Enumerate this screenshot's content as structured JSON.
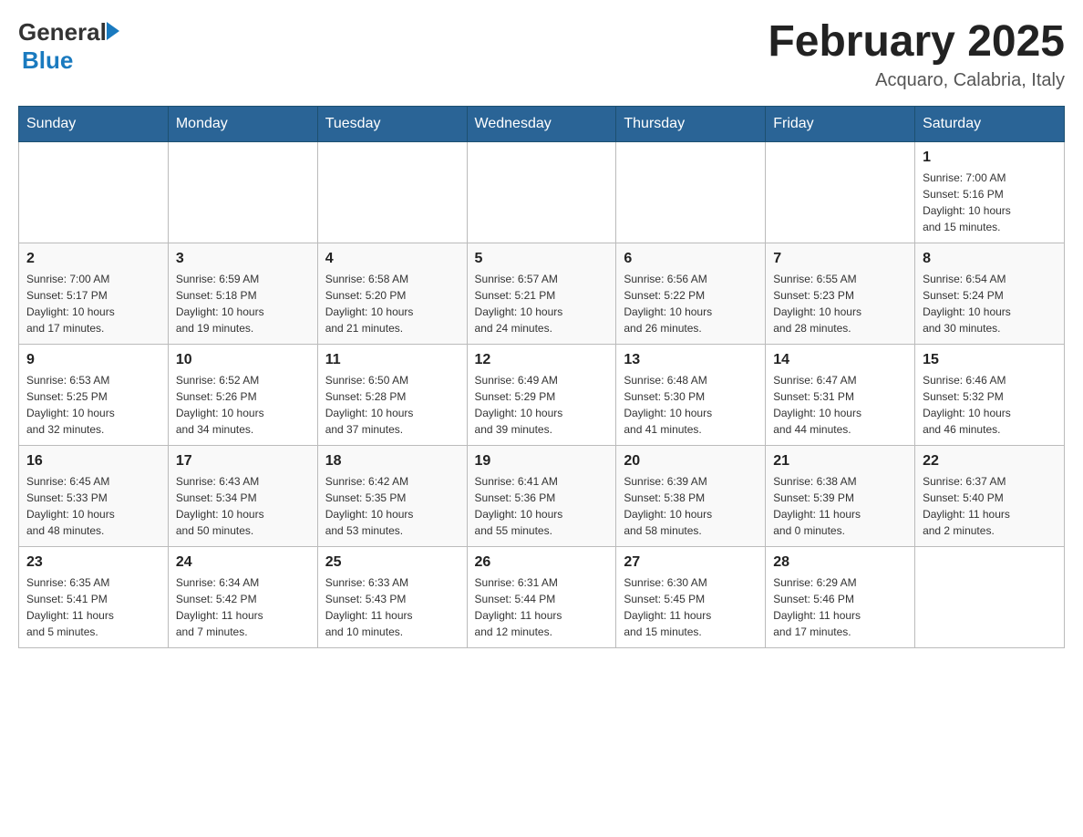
{
  "logo": {
    "general": "General",
    "blue": "Blue"
  },
  "title": "February 2025",
  "location": "Acquaro, Calabria, Italy",
  "days_of_week": [
    "Sunday",
    "Monday",
    "Tuesday",
    "Wednesday",
    "Thursday",
    "Friday",
    "Saturday"
  ],
  "weeks": [
    [
      {
        "day": "",
        "info": ""
      },
      {
        "day": "",
        "info": ""
      },
      {
        "day": "",
        "info": ""
      },
      {
        "day": "",
        "info": ""
      },
      {
        "day": "",
        "info": ""
      },
      {
        "day": "",
        "info": ""
      },
      {
        "day": "1",
        "info": "Sunrise: 7:00 AM\nSunset: 5:16 PM\nDaylight: 10 hours\nand 15 minutes."
      }
    ],
    [
      {
        "day": "2",
        "info": "Sunrise: 7:00 AM\nSunset: 5:17 PM\nDaylight: 10 hours\nand 17 minutes."
      },
      {
        "day": "3",
        "info": "Sunrise: 6:59 AM\nSunset: 5:18 PM\nDaylight: 10 hours\nand 19 minutes."
      },
      {
        "day": "4",
        "info": "Sunrise: 6:58 AM\nSunset: 5:20 PM\nDaylight: 10 hours\nand 21 minutes."
      },
      {
        "day": "5",
        "info": "Sunrise: 6:57 AM\nSunset: 5:21 PM\nDaylight: 10 hours\nand 24 minutes."
      },
      {
        "day": "6",
        "info": "Sunrise: 6:56 AM\nSunset: 5:22 PM\nDaylight: 10 hours\nand 26 minutes."
      },
      {
        "day": "7",
        "info": "Sunrise: 6:55 AM\nSunset: 5:23 PM\nDaylight: 10 hours\nand 28 minutes."
      },
      {
        "day": "8",
        "info": "Sunrise: 6:54 AM\nSunset: 5:24 PM\nDaylight: 10 hours\nand 30 minutes."
      }
    ],
    [
      {
        "day": "9",
        "info": "Sunrise: 6:53 AM\nSunset: 5:25 PM\nDaylight: 10 hours\nand 32 minutes."
      },
      {
        "day": "10",
        "info": "Sunrise: 6:52 AM\nSunset: 5:26 PM\nDaylight: 10 hours\nand 34 minutes."
      },
      {
        "day": "11",
        "info": "Sunrise: 6:50 AM\nSunset: 5:28 PM\nDaylight: 10 hours\nand 37 minutes."
      },
      {
        "day": "12",
        "info": "Sunrise: 6:49 AM\nSunset: 5:29 PM\nDaylight: 10 hours\nand 39 minutes."
      },
      {
        "day": "13",
        "info": "Sunrise: 6:48 AM\nSunset: 5:30 PM\nDaylight: 10 hours\nand 41 minutes."
      },
      {
        "day": "14",
        "info": "Sunrise: 6:47 AM\nSunset: 5:31 PM\nDaylight: 10 hours\nand 44 minutes."
      },
      {
        "day": "15",
        "info": "Sunrise: 6:46 AM\nSunset: 5:32 PM\nDaylight: 10 hours\nand 46 minutes."
      }
    ],
    [
      {
        "day": "16",
        "info": "Sunrise: 6:45 AM\nSunset: 5:33 PM\nDaylight: 10 hours\nand 48 minutes."
      },
      {
        "day": "17",
        "info": "Sunrise: 6:43 AM\nSunset: 5:34 PM\nDaylight: 10 hours\nand 50 minutes."
      },
      {
        "day": "18",
        "info": "Sunrise: 6:42 AM\nSunset: 5:35 PM\nDaylight: 10 hours\nand 53 minutes."
      },
      {
        "day": "19",
        "info": "Sunrise: 6:41 AM\nSunset: 5:36 PM\nDaylight: 10 hours\nand 55 minutes."
      },
      {
        "day": "20",
        "info": "Sunrise: 6:39 AM\nSunset: 5:38 PM\nDaylight: 10 hours\nand 58 minutes."
      },
      {
        "day": "21",
        "info": "Sunrise: 6:38 AM\nSunset: 5:39 PM\nDaylight: 11 hours\nand 0 minutes."
      },
      {
        "day": "22",
        "info": "Sunrise: 6:37 AM\nSunset: 5:40 PM\nDaylight: 11 hours\nand 2 minutes."
      }
    ],
    [
      {
        "day": "23",
        "info": "Sunrise: 6:35 AM\nSunset: 5:41 PM\nDaylight: 11 hours\nand 5 minutes."
      },
      {
        "day": "24",
        "info": "Sunrise: 6:34 AM\nSunset: 5:42 PM\nDaylight: 11 hours\nand 7 minutes."
      },
      {
        "day": "25",
        "info": "Sunrise: 6:33 AM\nSunset: 5:43 PM\nDaylight: 11 hours\nand 10 minutes."
      },
      {
        "day": "26",
        "info": "Sunrise: 6:31 AM\nSunset: 5:44 PM\nDaylight: 11 hours\nand 12 minutes."
      },
      {
        "day": "27",
        "info": "Sunrise: 6:30 AM\nSunset: 5:45 PM\nDaylight: 11 hours\nand 15 minutes."
      },
      {
        "day": "28",
        "info": "Sunrise: 6:29 AM\nSunset: 5:46 PM\nDaylight: 11 hours\nand 17 minutes."
      },
      {
        "day": "",
        "info": ""
      }
    ]
  ]
}
